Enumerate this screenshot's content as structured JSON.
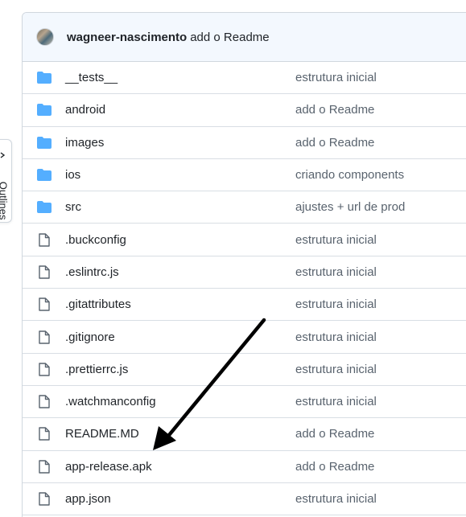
{
  "side_tab": {
    "label": "Outlines",
    "chevron_icon": "chevron-right-icon"
  },
  "commit": {
    "author": "wagneer-nascimento",
    "message": "add o Readme",
    "avatar_icon": "user-avatar"
  },
  "files": [
    {
      "type": "folder",
      "name": "__tests__",
      "message": "estrutura inicial"
    },
    {
      "type": "folder",
      "name": "android",
      "message": "add o Readme"
    },
    {
      "type": "folder",
      "name": "images",
      "message": "add o Readme"
    },
    {
      "type": "folder",
      "name": "ios",
      "message": "criando components"
    },
    {
      "type": "folder",
      "name": "src",
      "message": "ajustes + url de prod"
    },
    {
      "type": "file",
      "name": ".buckconfig",
      "message": "estrutura inicial"
    },
    {
      "type": "file",
      "name": ".eslintrc.js",
      "message": "estrutura inicial"
    },
    {
      "type": "file",
      "name": ".gitattributes",
      "message": "estrutura inicial"
    },
    {
      "type": "file",
      "name": ".gitignore",
      "message": "estrutura inicial"
    },
    {
      "type": "file",
      "name": ".prettierrc.js",
      "message": "estrutura inicial"
    },
    {
      "type": "file",
      "name": ".watchmanconfig",
      "message": "estrutura inicial"
    },
    {
      "type": "file",
      "name": "README.MD",
      "message": "add o Readme"
    },
    {
      "type": "file",
      "name": "app-release.apk",
      "message": "add o Readme"
    },
    {
      "type": "file",
      "name": "app.json",
      "message": "estrutura inicial"
    }
  ],
  "colors": {
    "folder": "#54aeff",
    "file_icon": "#59636e",
    "header_bg": "#f3f8fe",
    "border": "#d0d7de",
    "annotation_arrow": "#000000"
  },
  "annotation": {
    "icon": "arrow-pointing-to-app-release-apk"
  }
}
